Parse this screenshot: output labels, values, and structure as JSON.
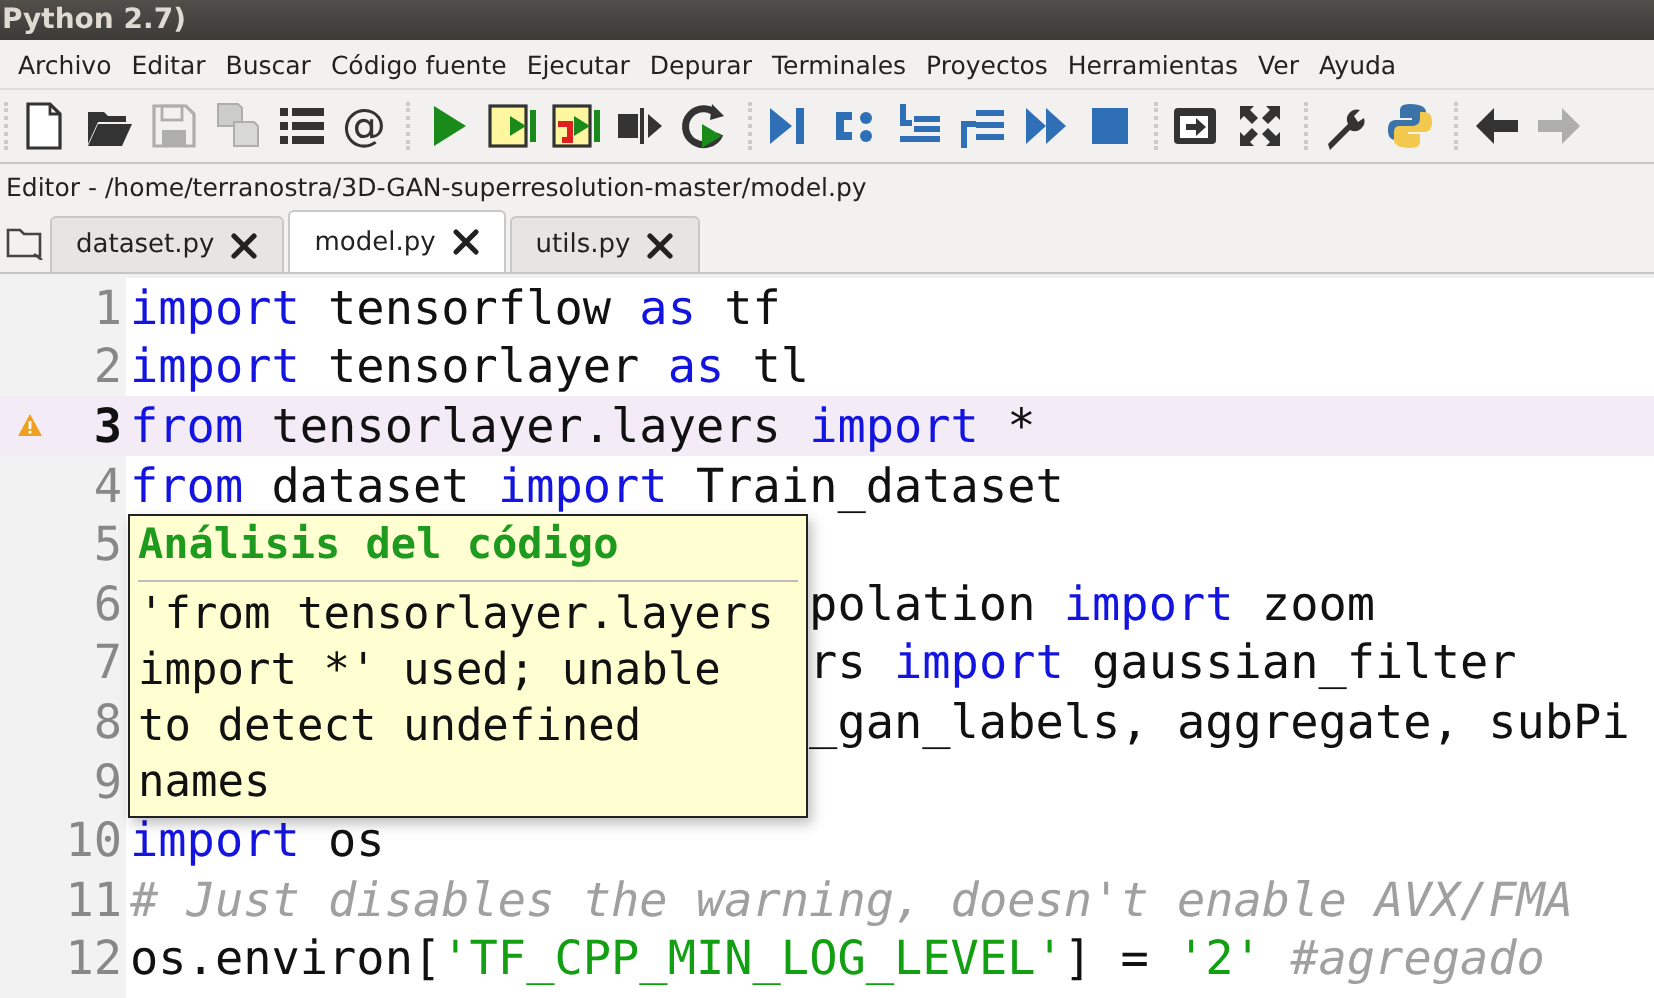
{
  "window": {
    "title": "Python 2.7)"
  },
  "menu": [
    {
      "label": "Archivo"
    },
    {
      "label": "Editar"
    },
    {
      "label": "Buscar"
    },
    {
      "label": "Código fuente"
    },
    {
      "label": "Ejecutar"
    },
    {
      "label": "Depurar"
    },
    {
      "label": "Terminales"
    },
    {
      "label": "Proyectos"
    },
    {
      "label": "Herramientas"
    },
    {
      "label": "Ver"
    },
    {
      "label": "Ayuda"
    }
  ],
  "toolbar": [
    [
      {
        "disabled": false
      },
      {
        "disabled": false
      },
      {
        "disabled": true
      },
      {
        "disabled": true
      },
      {
        "disabled": false
      },
      {
        "disabled": false,
        "glyph": "@"
      }
    ],
    [
      {
        "disabled": false
      },
      {
        "disabled": false
      },
      {
        "disabled": false
      },
      {
        "disabled": false
      },
      {
        "disabled": false
      }
    ],
    [
      {
        "disabled": false
      },
      {
        "disabled": false
      },
      {
        "disabled": false
      },
      {
        "disabled": false
      },
      {
        "disabled": false
      },
      {
        "disabled": false
      }
    ],
    [
      {
        "disabled": false
      },
      {
        "disabled": false
      }
    ],
    [
      {
        "disabled": false
      },
      {
        "disabled": false
      }
    ],
    [
      {
        "disabled": false
      },
      {
        "disabled": true
      }
    ]
  ],
  "editor_path": "Editor - /home/terranostra/3D-GAN-superresolution-master/model.py",
  "tabs": [
    {
      "label": "dataset.py",
      "selected": false
    },
    {
      "label": "model.py",
      "selected": true
    },
    {
      "label": "utils.py",
      "selected": false
    }
  ],
  "code_lines": [
    {
      "number": "1",
      "current": false,
      "warning": false,
      "covered": false,
      "tokens": [
        {
          "kind": "keyword",
          "text": "import"
        },
        {
          "kind": "plain",
          "text": " tensorflow "
        },
        {
          "kind": "keyword",
          "text": "as"
        },
        {
          "kind": "plain",
          "text": " tf"
        }
      ]
    },
    {
      "number": "2",
      "current": false,
      "warning": false,
      "covered": false,
      "tokens": [
        {
          "kind": "keyword",
          "text": "import"
        },
        {
          "kind": "plain",
          "text": " tensorlayer "
        },
        {
          "kind": "keyword",
          "text": "as"
        },
        {
          "kind": "plain",
          "text": " tl"
        }
      ]
    },
    {
      "number": "3",
      "current": true,
      "warning": true,
      "covered": false,
      "tokens": [
        {
          "kind": "keyword",
          "text": "from"
        },
        {
          "kind": "plain",
          "text": " tensorlayer.layers "
        },
        {
          "kind": "keyword",
          "text": "import"
        },
        {
          "kind": "plain",
          "text": " *"
        }
      ]
    },
    {
      "number": "4",
      "current": false,
      "warning": false,
      "covered": false,
      "tokens": [
        {
          "kind": "keyword",
          "text": "from"
        },
        {
          "kind": "plain",
          "text": " dataset "
        },
        {
          "kind": "keyword",
          "text": "import"
        },
        {
          "kind": "plain",
          "text": " Train_dataset"
        }
      ]
    },
    {
      "number": "5",
      "current": false,
      "warning": false
    },
    {
      "number": "6",
      "current": false,
      "warning": false,
      "covered": true,
      "tokens": [
        {
          "kind": "plain",
          "text": "polation "
        },
        {
          "kind": "keyword",
          "text": "import"
        },
        {
          "kind": "plain",
          "text": " zoom"
        }
      ]
    },
    {
      "number": "7",
      "current": false,
      "warning": false,
      "covered": true,
      "tokens": [
        {
          "kind": "plain",
          "text": "rs "
        },
        {
          "kind": "keyword",
          "text": "import"
        },
        {
          "kind": "plain",
          "text": " gaussian_filter"
        }
      ]
    },
    {
      "number": "8",
      "current": false,
      "warning": false,
      "covered": true,
      "tokens": [
        {
          "kind": "plain",
          "text": "_gan_labels, aggregate, subPi"
        }
      ]
    },
    {
      "number": "9",
      "current": false,
      "warning": false
    },
    {
      "number": "10",
      "current": false,
      "warning": false,
      "covered": false,
      "tokens": [
        {
          "kind": "keyword",
          "text": "import"
        },
        {
          "kind": "plain",
          "text": " os"
        }
      ]
    },
    {
      "number": "11",
      "current": false,
      "warning": false,
      "covered": false,
      "tokens": [
        {
          "kind": "comment",
          "text": "# Just disables the warning, doesn't enable AVX/FMA"
        }
      ]
    },
    {
      "number": "12",
      "current": false,
      "warning": false,
      "covered": false,
      "tokens": [
        {
          "kind": "plain",
          "text": "os.environ["
        },
        {
          "kind": "string",
          "text": "'TF_CPP_MIN_LOG_LEVEL'"
        },
        {
          "kind": "plain",
          "text": "] = "
        },
        {
          "kind": "string",
          "text": "'2'"
        },
        {
          "kind": "comment",
          "text": " #agregado"
        }
      ]
    }
  ],
  "tooltip": {
    "title": "Análisis del código",
    "message": "'from tensorlayer.layers import *' used; unable to detect undefined names"
  }
}
